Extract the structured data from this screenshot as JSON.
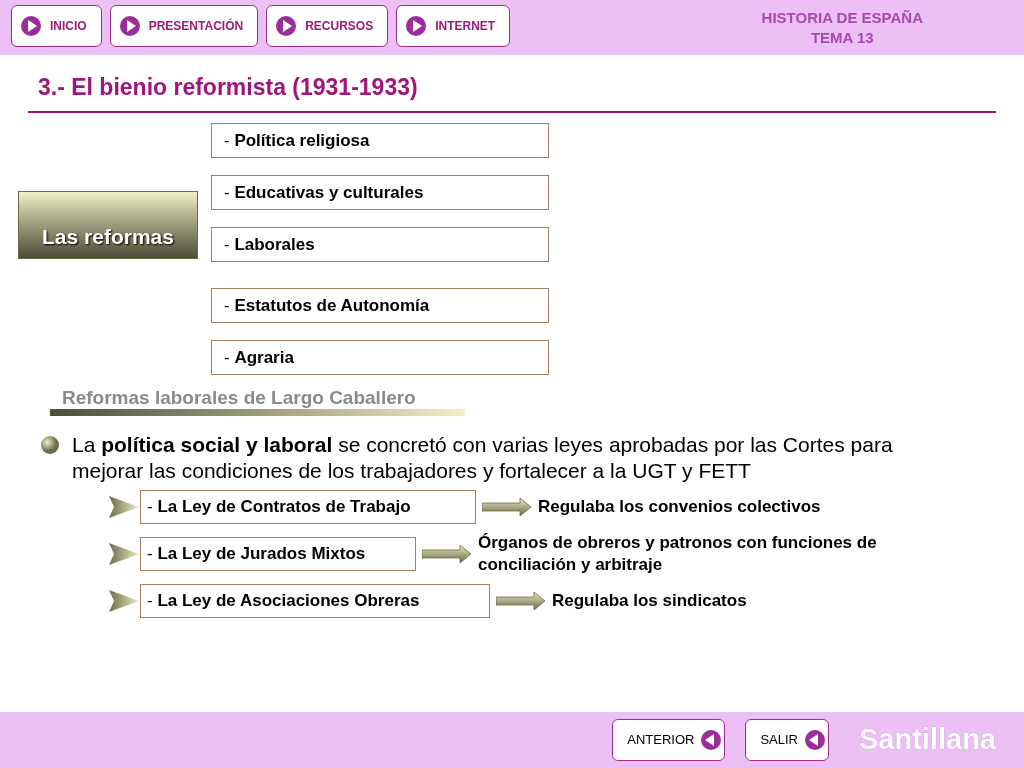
{
  "header": {
    "nav_buttons": [
      "INICIO",
      "PRESENTACIÓN",
      "RECURSOS",
      "INTERNET"
    ],
    "subject": "HISTORIA DE ESPAÑA",
    "unit": "TEMA 13"
  },
  "title": "3.- El bienio reformista (1931-1933)",
  "reforms": {
    "label": "Las reformas",
    "items": [
      "- **Política religiosa**",
      "- **Educativas y culturales**",
      "- **Laborales**",
      "- **Estatutos de Autonomía**",
      "- **Agraria**"
    ]
  },
  "section_heading": "Reformas laborales de Largo Caballero",
  "paragraph": "La **política social y laboral** se concretó con varias leyes aprobadas por las Cortes para mejorar las condiciones de los trabajadores y fortalecer a la UGT y FETT",
  "laws": [
    {
      "name": "- **La Ley de Contratos de Trabajo**",
      "description": "Regulaba los convenios colectivos"
    },
    {
      "name": "- **La Ley de Jurados Mixtos**",
      "description": "Órganos de obreros y patronos con funciones de conciliación y arbitraje"
    },
    {
      "name": "- **La Ley de Asociaciones Obreras**",
      "description": "Regulaba los sindicatos"
    }
  ],
  "footer": {
    "buttons": [
      "ANTERIOR",
      "SALIR"
    ],
    "brand": "Santillana"
  }
}
